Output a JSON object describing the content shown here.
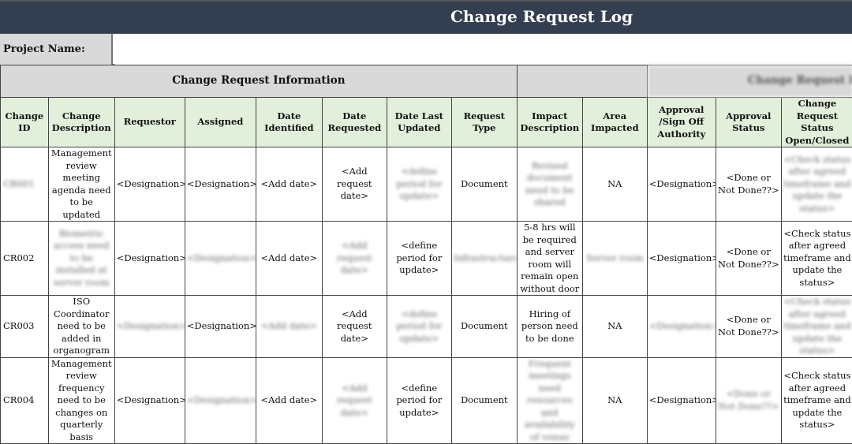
{
  "title": "Change Request Log",
  "project": {
    "label": "Project Name:",
    "value": ""
  },
  "groups": {
    "info": "Change Request Information",
    "impact": "",
    "response": "Change Request Response"
  },
  "columns": [
    "Change ID",
    "Change Description",
    "Requestor",
    "Assigned",
    "Date Identified",
    "Date Requested",
    "Date Last Updated",
    "Request Type",
    "Impact Description",
    "Area Impacted",
    "Approval /Sign Off Authority",
    "Approval Status",
    "Change Request Status Open/Closed"
  ],
  "rows": [
    {
      "id": "CR001",
      "description": "Management review meeting agenda need to be updated",
      "requestor": "<Designation>",
      "assigned": "<Designation>",
      "date_identified": "<Add date>",
      "date_requested": "<Add request date>",
      "date_last_updated": "<define period for update>",
      "request_type": "Document",
      "impact_description": "Revised document need to be shared",
      "area_impacted": "NA",
      "approval_authority": "<Designation>",
      "approval_status": "<Done or Not Done??>",
      "cr_status": "<Check status after agreed timeframe and update the status>"
    },
    {
      "id": "CR002",
      "description": "Biometric access need to be installed at server room",
      "requestor": "<Designation>",
      "assigned": "<Designation>",
      "date_identified": "<Add date>",
      "date_requested": "<Add request date>",
      "date_last_updated": "<define period for update>",
      "request_type": "Infrastructure",
      "impact_description": "5-8 hrs will be required and server room will remain open without door",
      "area_impacted": "Server room",
      "approval_authority": "<Designation>",
      "approval_status": "<Done or Not Done??>",
      "cr_status": "<Check status after agreed timeframe and update the status>"
    },
    {
      "id": "CR003",
      "description": "ISO Coordinator need to be added in organogram",
      "requestor": "<Designation>",
      "assigned": "<Designation>",
      "date_identified": "<Add date>",
      "date_requested": "<Add request date>",
      "date_last_updated": "<define period for update>",
      "request_type": "Document",
      "impact_description": "Hiring of person need to be done",
      "area_impacted": "NA",
      "approval_authority": "<Designation>",
      "approval_status": "<Done or Not Done??>",
      "cr_status": "<Check status after agreed timeframe and update the status>"
    },
    {
      "id": "CR004",
      "description": "Management review frequency need to be changes on quarterly basis",
      "requestor": "<Designation>",
      "assigned": "<Designation>",
      "date_identified": "<Add date>",
      "date_requested": "<Add request date>",
      "date_last_updated": "<define period for update>",
      "request_type": "Document",
      "impact_description": "Frequent meetings need resources and availability of venue",
      "area_impacted": "NA",
      "approval_authority": "<Designation>",
      "approval_status": "<Done or Not Done??>",
      "cr_status": "<Check status after agreed timeframe and update the status>"
    }
  ]
}
